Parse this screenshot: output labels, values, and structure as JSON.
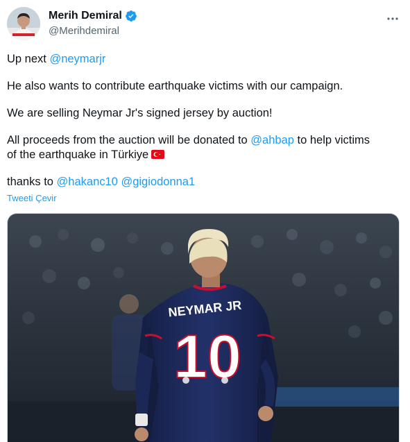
{
  "author": {
    "display_name": "Merih Demiral",
    "handle": "@Merihdemiral",
    "verified": true,
    "avatar_icon": "avatar-player-photo",
    "verified_icon": "verified-badge-icon"
  },
  "menu": {
    "icon": "more-horizontal-icon"
  },
  "tweet": {
    "line1_prefix": "Up next ",
    "line1_mention": "@neymarjr",
    "line2": "He also wants to contribute earthquake victims with our campaign.",
    "line3": "We are selling Neymar Jr's signed jersey by auction!",
    "line4_prefix": "All proceeds from the auction will be donated to ",
    "line4_mention": "@ahbap",
    "line4_suffix": " to help victims",
    "line5_text": "of the earthquake in Türkiye",
    "line5_flag": "turkey-flag-icon",
    "line6_prefix": "thanks to ",
    "line6_mention1": "@hakanc10",
    "line6_mention2": "@gigiodonna1"
  },
  "translate_label": "Tweeti Çevir",
  "media": {
    "jersey_name": "NEYMAR JR",
    "jersey_number": "10"
  },
  "colors": {
    "link": "#1d9bf0",
    "text": "#0f1419",
    "secondary": "#536471",
    "verified": "#1d9bf0",
    "jersey": "#1b2a5c"
  }
}
